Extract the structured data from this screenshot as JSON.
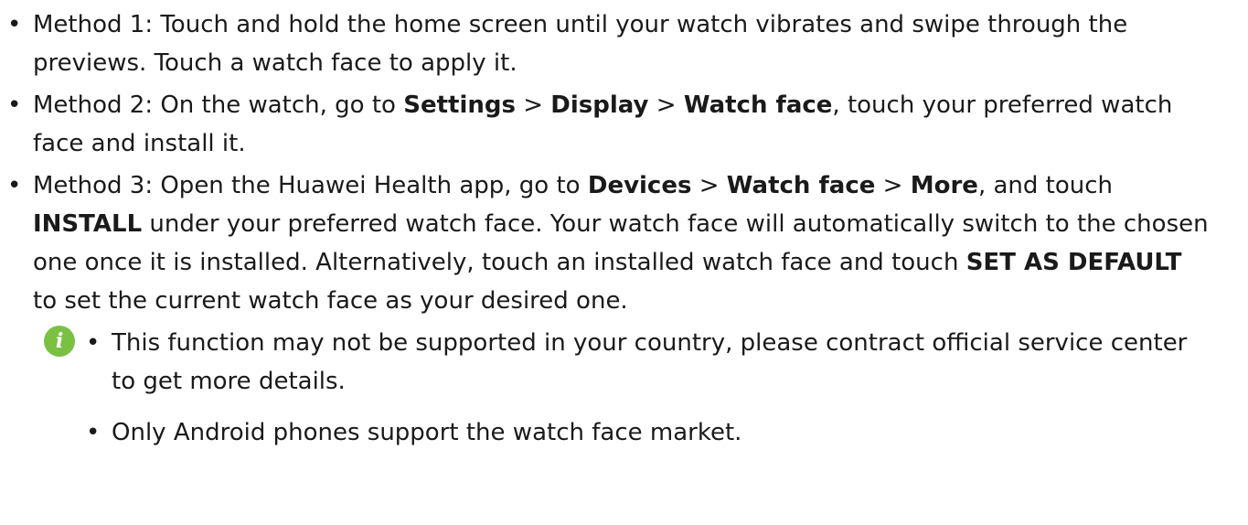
{
  "method1": {
    "bullet": "•",
    "text": "Method 1: Touch and hold the home screen until your watch vibrates and swipe through the previews. Touch a watch face to apply it."
  },
  "method2": {
    "bullet": "•",
    "t1": "Method 2: On the watch, go to ",
    "b1": "Settings",
    "t2": " > ",
    "b2": "Display",
    "t3": " > ",
    "b3": "Watch face",
    "t4": ", touch your preferred watch face and install it."
  },
  "method3": {
    "bullet": "•",
    "t1": "Method 3: Open the Huawei Health app, go to ",
    "b1": "Devices",
    "t2": " > ",
    "b2": "Watch face",
    "t3": " > ",
    "b3": "More",
    "t4": ", and touch ",
    "b4": "INSTALL",
    "t5": " under your preferred watch face. Your watch face will automatically switch to the chosen one once it is installed. Alternatively, touch an installed watch face and touch ",
    "b5": "SET AS DEFAULT",
    "t6": " to set the current watch face as your desired one."
  },
  "note": {
    "icon": "i",
    "icon_name": "info-icon",
    "icon_color": "#7ac143",
    "items": [
      {
        "bullet": "•",
        "text": "This function may not be supported in your country, please contract official service center to get more details."
      },
      {
        "bullet": "•",
        "text": "Only Android phones support the watch face market."
      }
    ]
  }
}
